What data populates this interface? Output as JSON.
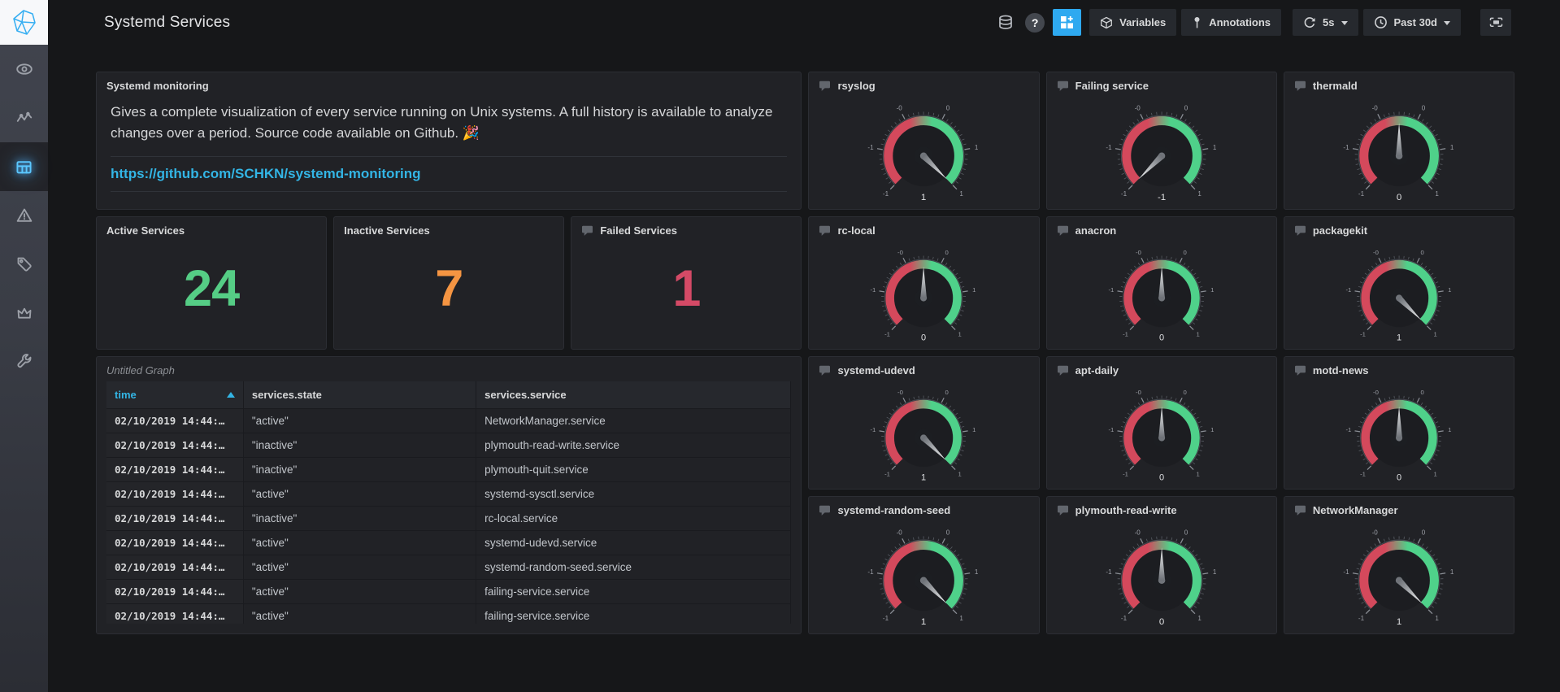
{
  "header": {
    "title": "Systemd Services",
    "toolbar": {
      "variables": "Variables",
      "annotations": "Annotations",
      "refresh_interval": "5s",
      "time_range": "Past 30d"
    }
  },
  "sidebar": {
    "items": [
      {
        "icon": "eye-icon"
      },
      {
        "icon": "activity-icon"
      },
      {
        "icon": "dashboards-icon",
        "active": true
      },
      {
        "icon": "alert-triangle-icon"
      },
      {
        "icon": "tag-icon"
      },
      {
        "icon": "crown-icon"
      },
      {
        "icon": "wrench-icon"
      }
    ]
  },
  "panels": {
    "text": {
      "title": "Systemd monitoring",
      "body": "Gives a complete visualization of every service running on Unix systems. A full history is available to analyze changes over a period. Source code available on Github. 🎉",
      "link": "https://github.com/SCHKN/systemd-monitoring"
    },
    "stats": [
      {
        "title": "Active Services",
        "value": "24",
        "color": "#55cd85"
      },
      {
        "title": "Inactive Services",
        "value": "7",
        "color": "#f59542"
      },
      {
        "title": "Failed Services",
        "value": "1",
        "color": "#d44a66"
      }
    ],
    "table": {
      "title": "Untitled Graph",
      "columns": [
        "time",
        "services.state",
        "services.service"
      ],
      "sort": {
        "column": "time",
        "direction": "asc"
      },
      "rows": [
        [
          "02/10/2019 14:44:…",
          "\"active\"",
          "NetworkManager.service"
        ],
        [
          "02/10/2019 14:44:…",
          "\"inactive\"",
          "plymouth-read-write.service"
        ],
        [
          "02/10/2019 14:44:…",
          "\"inactive\"",
          "plymouth-quit.service"
        ],
        [
          "02/10/2019 14:44:…",
          "\"active\"",
          "systemd-sysctl.service"
        ],
        [
          "02/10/2019 14:44:…",
          "\"inactive\"",
          "rc-local.service"
        ],
        [
          "02/10/2019 14:44:…",
          "\"active\"",
          "systemd-udevd.service"
        ],
        [
          "02/10/2019 14:44:…",
          "\"active\"",
          "systemd-random-seed.service"
        ],
        [
          "02/10/2019 14:44:…",
          "\"active\"",
          "failing-service.service"
        ],
        [
          "02/10/2019 14:44:…",
          "\"active\"",
          "failing-service.service"
        ]
      ]
    },
    "gauges": [
      {
        "title": "rsyslog",
        "value": 1
      },
      {
        "title": "Failing service",
        "value": -1
      },
      {
        "title": "thermald",
        "value": 0
      },
      {
        "title": "rc-local",
        "value": 0
      },
      {
        "title": "anacron",
        "value": 0
      },
      {
        "title": "packagekit",
        "value": 1
      },
      {
        "title": "systemd-udevd",
        "value": 1
      },
      {
        "title": "apt-daily",
        "value": 0
      },
      {
        "title": "motd-news",
        "value": 0
      },
      {
        "title": "systemd-random-seed",
        "value": 1
      },
      {
        "title": "plymouth-read-write",
        "value": 0
      },
      {
        "title": "NetworkManager",
        "value": 1
      }
    ],
    "gauge_config": {
      "min": -1,
      "max": 1,
      "tick_labels": [
        "-1",
        "-1",
        "-0",
        "0",
        "1",
        "1"
      ],
      "color_low": "#d4495c",
      "color_high": "#4fd18a"
    }
  },
  "colors": {
    "accent_blue": "#33b5e5",
    "stat_green": "#55cd85",
    "stat_orange": "#f59542",
    "stat_red": "#d44a66",
    "panel_bg": "#212226",
    "page_bg": "#161719"
  }
}
